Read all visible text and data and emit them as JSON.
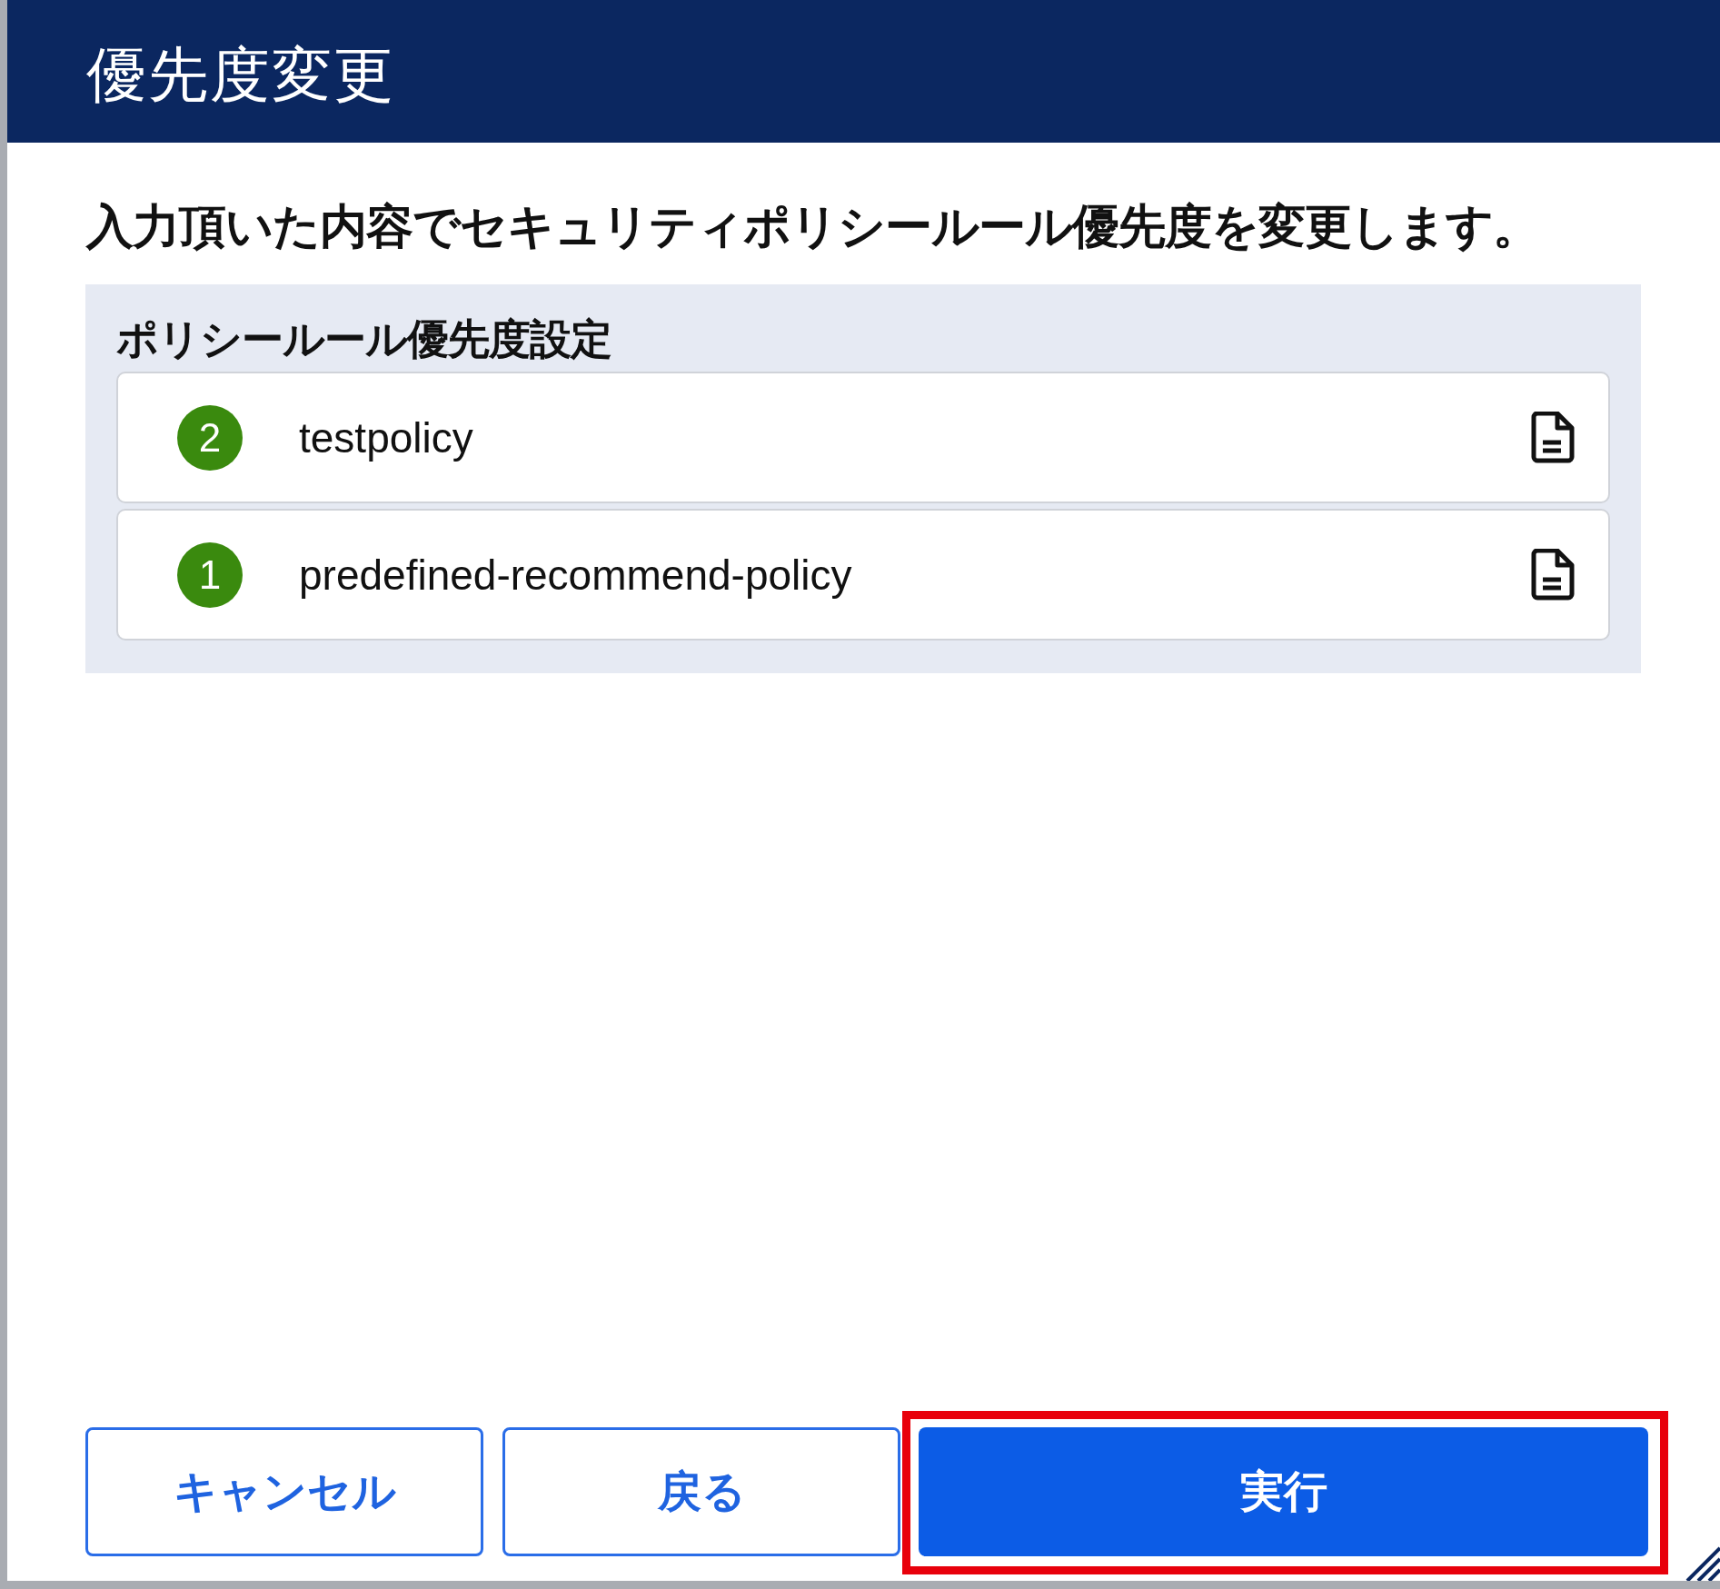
{
  "dialog": {
    "title": "優先度変更",
    "message": "入力頂いた内容でセキュリティポリシールール優先度を変更します。",
    "panel": {
      "heading": "ポリシールール優先度設定",
      "rules": [
        {
          "priority": "2",
          "name": "testpolicy"
        },
        {
          "priority": "1",
          "name": "predefined-recommend-policy"
        }
      ]
    },
    "buttons": [
      {
        "label": "キャンセル",
        "kind": "outline",
        "highlighted": false
      },
      {
        "label": "戻る",
        "kind": "outline",
        "highlighted": false
      },
      {
        "label": "実行",
        "kind": "primary",
        "highlighted": true
      }
    ]
  }
}
